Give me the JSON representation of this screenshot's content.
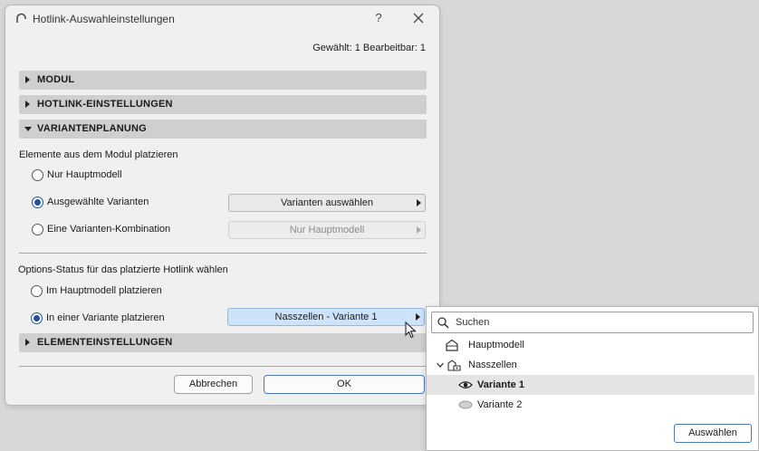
{
  "dialog": {
    "title": "Hotlink-Auswahleinstellungen",
    "help": "?",
    "selection_status": "Gewählt: 1 Bearbeitbar: 1"
  },
  "sections": {
    "modul": "MODUL",
    "hotlink": "HOTLINK-EINSTELLUNGEN",
    "varianten": "VARIANTENPLANUNG",
    "element": "ELEMENTEINSTELLUNGEN"
  },
  "placement": {
    "label": "Elemente aus dem Modul platzieren",
    "options": [
      {
        "label": "Nur Hauptmodell",
        "checked": false
      },
      {
        "label": "Ausgewählte Varianten",
        "checked": true
      },
      {
        "label": "Eine Varianten-Kombination",
        "checked": false
      }
    ],
    "select_variants_button": "Varianten auswählen",
    "combination_button": "Nur Hauptmodell"
  },
  "options_status": {
    "label": "Options-Status für das platzierte Hotlink wählen",
    "options": [
      {
        "label": "Im Hauptmodell platzieren",
        "checked": false
      },
      {
        "label": "In einer Variante platzieren",
        "checked": true
      }
    ],
    "variant_button": "Nasszellen - Variante 1"
  },
  "footer": {
    "cancel": "Abbrechen",
    "ok": "OK"
  },
  "dropdown": {
    "search_placeholder": "Suchen",
    "items": [
      {
        "label": "Hauptmodell",
        "icon": "house-icon"
      },
      {
        "label": "Nasszellen",
        "icon": "folder-tree-icon",
        "expanded": true
      },
      {
        "label": "Variante 1",
        "icon": "eye-icon",
        "selected": true
      },
      {
        "label": "Variante 2",
        "icon": "ellipse-icon"
      }
    ],
    "select_button": "Auswählen"
  },
  "colors": {
    "accent": "#1f4f9e",
    "section_bg": "#cfcfcf",
    "active_button": "#cde3fa"
  }
}
